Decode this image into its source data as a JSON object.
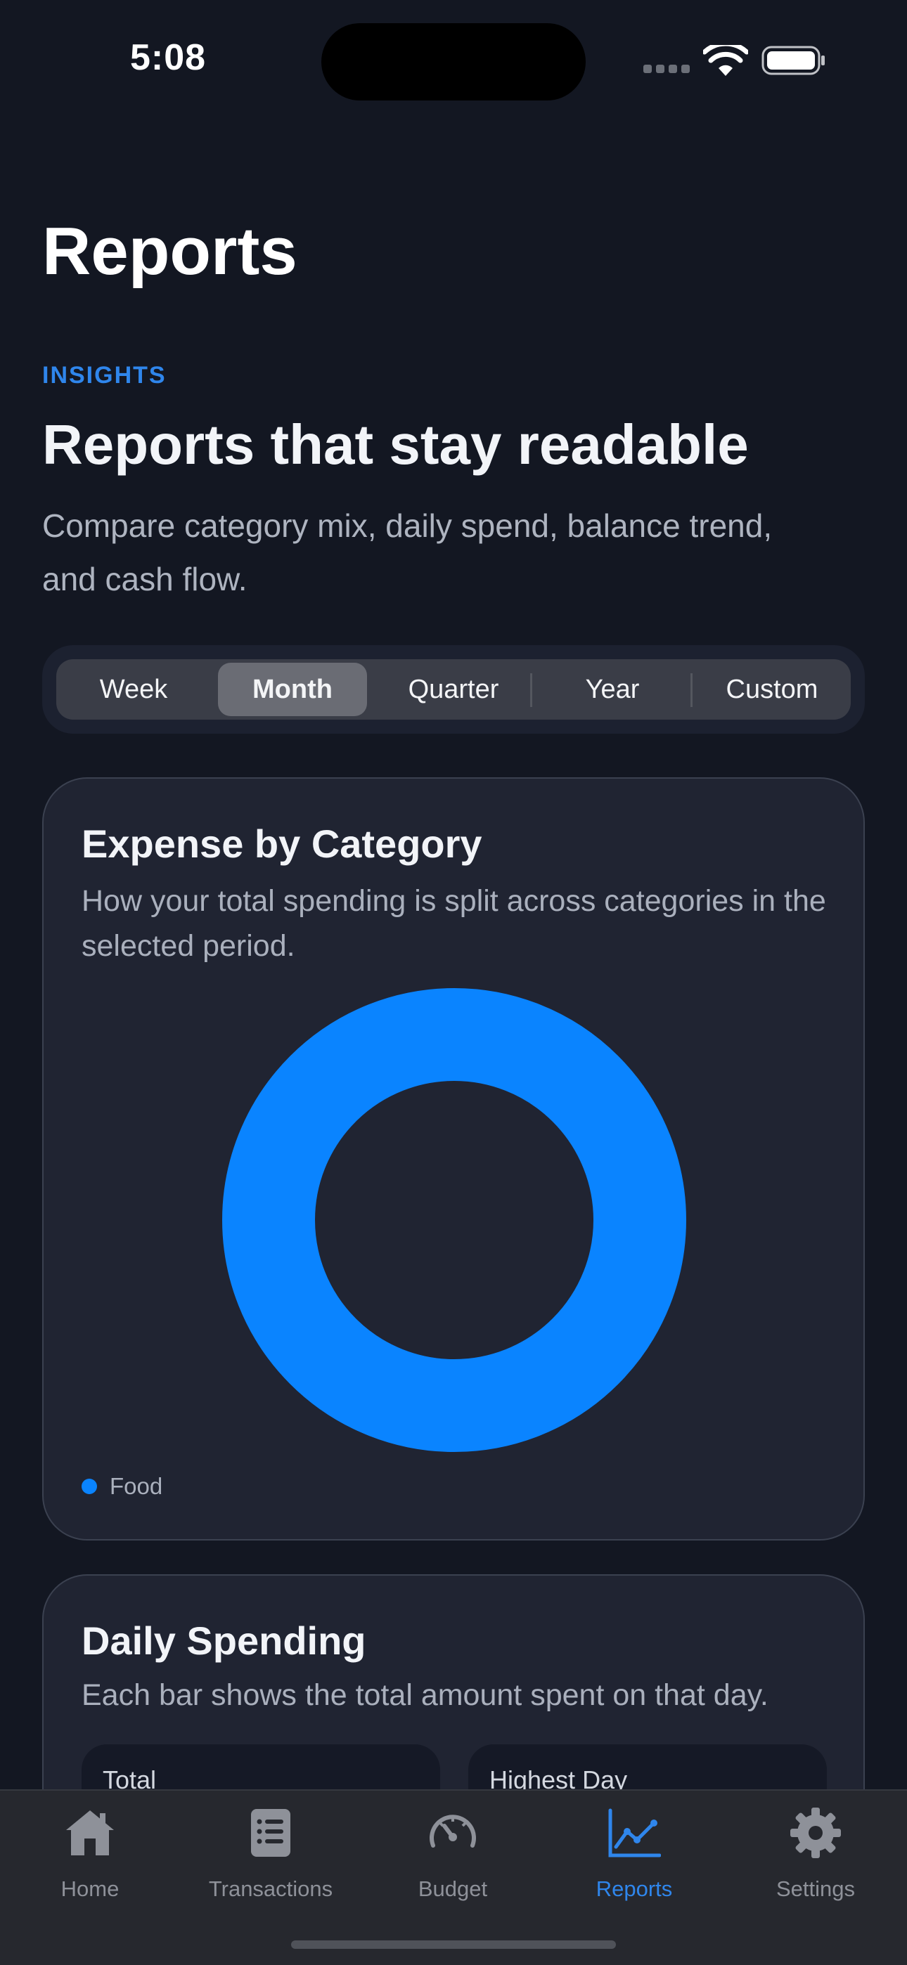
{
  "status_bar": {
    "time": "5:08"
  },
  "header": {
    "title": "Reports",
    "eyebrow": "INSIGHTS",
    "headline": "Reports that stay readable",
    "subtitle": "Compare category mix, daily spend, balance trend, and cash flow."
  },
  "period": {
    "options": [
      "Week",
      "Month",
      "Quarter",
      "Year",
      "Custom"
    ],
    "selected": "Month"
  },
  "expense_card": {
    "title": "Expense by Category",
    "description": "How your total spending is split across categories in the selected period.",
    "legend": [
      {
        "label": "Food",
        "color": "#0a84ff"
      }
    ]
  },
  "daily_card": {
    "title": "Daily Spending",
    "description": "Each bar shows the total amount spent on that day.",
    "stats": [
      {
        "label": "Total"
      },
      {
        "label": "Highest Day"
      }
    ]
  },
  "tabbar": {
    "items": [
      {
        "label": "Home",
        "icon": "house-icon"
      },
      {
        "label": "Transactions",
        "icon": "list-icon"
      },
      {
        "label": "Budget",
        "icon": "gauge-icon"
      },
      {
        "label": "Reports",
        "icon": "chart-line-icon"
      },
      {
        "label": "Settings",
        "icon": "gear-icon"
      }
    ],
    "active": "Reports"
  },
  "colors": {
    "accent": "#2f86ec",
    "chart_blue": "#0a84ff",
    "background": "#131722",
    "card": "#202432"
  },
  "chart_data": {
    "type": "pie",
    "categories": [
      "Food"
    ],
    "values": [
      100
    ],
    "legend_position": "bottom-left"
  }
}
